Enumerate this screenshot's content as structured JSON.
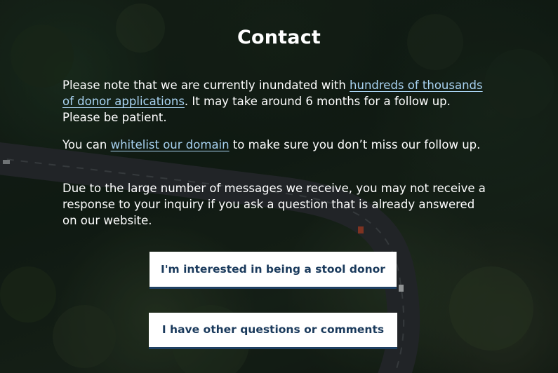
{
  "page": {
    "title": "Contact"
  },
  "paragraphs": {
    "p1_before": "Please note that we are currently inundated with ",
    "p1_link": "hundreds of thousands of donor applications",
    "p1_after": ". It may take around 6 months for a follow up. Please be patient.",
    "p2_before": "You can ",
    "p2_link": "whitelist our domain",
    "p2_after": " to make sure you don’t miss our follow up.",
    "p3": "Due to the large number of messages we receive, you may not receive a response to your inquiry if you ask a question that is already answered on our website."
  },
  "buttons": {
    "stool_donor": "I'm interested in being a stool donor",
    "other_questions": "I have other questions or comments"
  },
  "colors": {
    "link": "#a9d3f2",
    "button_text": "#1a3a5c",
    "button_border": "#1f4062",
    "text": "#ffffff"
  }
}
